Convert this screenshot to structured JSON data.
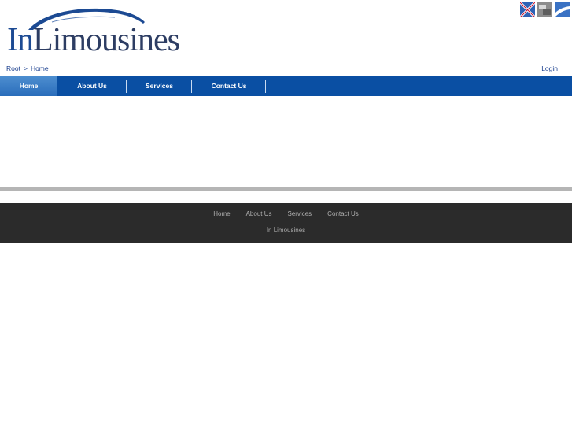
{
  "brand": {
    "logo_first": "In",
    "logo_rest": "Limousines",
    "accent_color": "#0a4fa3"
  },
  "flags": [
    {
      "icon": "flag-icon-1"
    },
    {
      "icon": "flag-icon-2"
    },
    {
      "icon": "flag-icon-3"
    }
  ],
  "breadcrumb": {
    "root": "Root",
    "separator": ">",
    "current": "Home"
  },
  "login_label": "Login",
  "nav": {
    "items": [
      {
        "label": "Home",
        "active": true
      },
      {
        "label": "About Us",
        "active": false
      },
      {
        "label": "Services",
        "active": false
      },
      {
        "label": "Contact Us",
        "active": false
      }
    ]
  },
  "footer": {
    "links": [
      "Home",
      "About Us",
      "Services",
      "Contact Us"
    ],
    "copyright": "In Limousines"
  }
}
